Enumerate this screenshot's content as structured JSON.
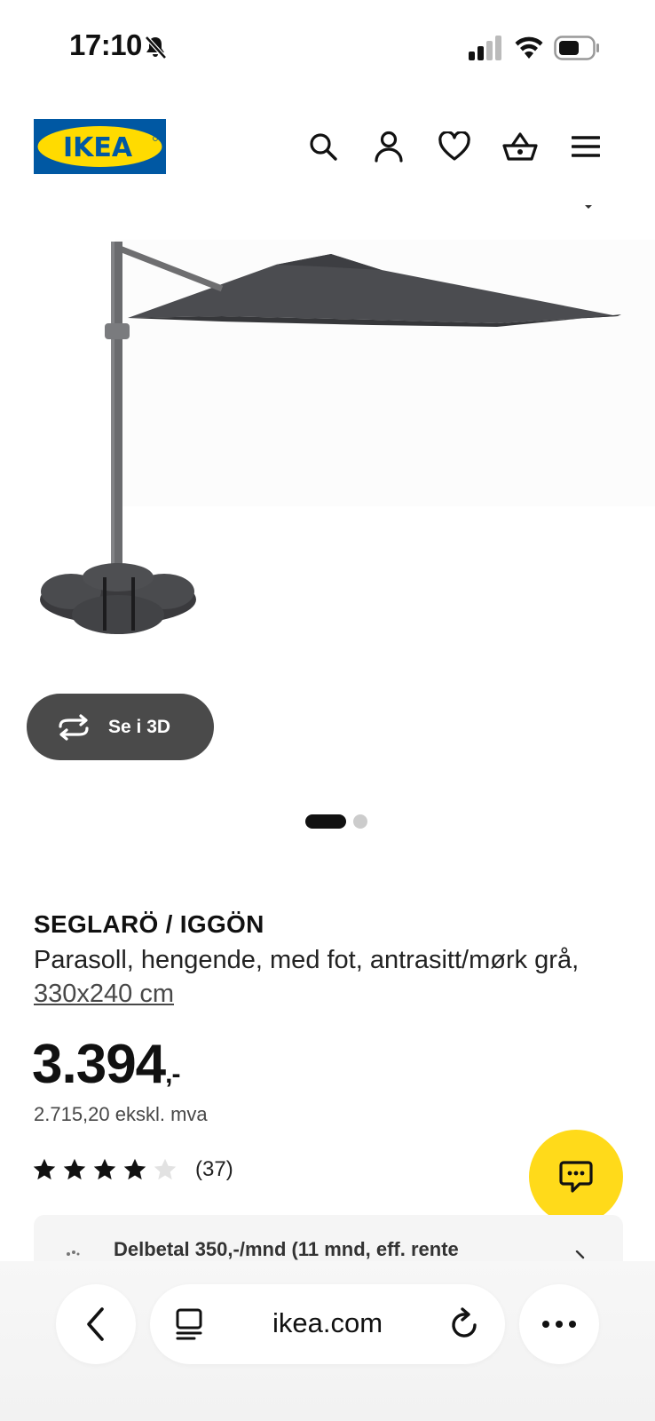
{
  "status_bar": {
    "time": "17:10",
    "icons": [
      "bell-slash-icon",
      "cellular-signal-icon",
      "wifi-icon",
      "battery-icon"
    ]
  },
  "header": {
    "logo_text": "IKEA",
    "icons": [
      "search-icon",
      "account-icon",
      "favorites-icon",
      "basket-icon",
      "menu-icon"
    ],
    "brand_colors": {
      "blue": "#0058a3",
      "yellow": "#ffdb00"
    }
  },
  "gallery": {
    "view_3d_label": "Se i 3D",
    "image_count": 2,
    "active_index": 0
  },
  "product": {
    "name": "SEGLARÖ / IGGÖN",
    "description": "Parasoll, hengende, med fot, antrasitt/mørk grå, ",
    "size_link": "330x240 cm",
    "price": "3.394",
    "price_suffix": ",-",
    "price_excl_vat": "2.715,20 ekskl. mva",
    "rating": 4,
    "rating_max": 5,
    "review_count": "(37)"
  },
  "financing": {
    "text": "Delbetal 350,-/mnd (11 mnd, eff. rente"
  },
  "chat": {
    "icon": "chat-icon",
    "color": "#ffda1a"
  },
  "browser": {
    "url": "ikea.com",
    "icons": [
      "back-icon",
      "tabs-icon",
      "reload-icon",
      "more-icon"
    ]
  }
}
